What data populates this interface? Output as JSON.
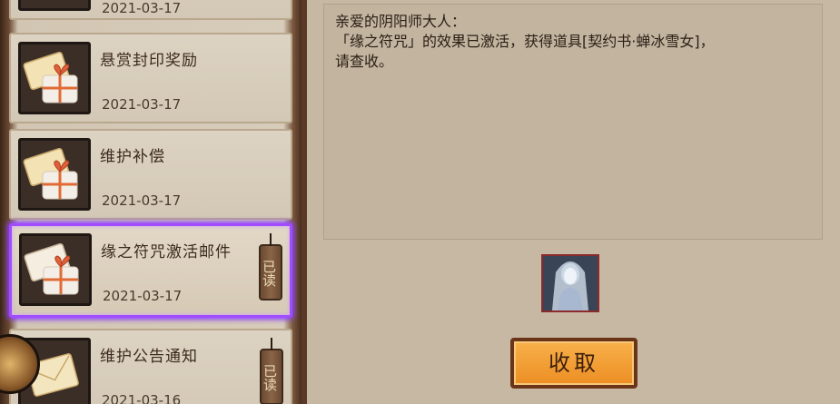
{
  "mail_list": [
    {
      "title": "",
      "date": "2021-03-17",
      "read": false,
      "icon": "gift-envelope-icon"
    },
    {
      "title": "悬赏封印奖励",
      "date": "2021-03-17",
      "read": false,
      "icon": "gift-envelope-icon"
    },
    {
      "title": "维护补偿",
      "date": "2021-03-17",
      "read": false,
      "icon": "gift-envelope-icon"
    },
    {
      "title": "缘之符咒激活邮件",
      "date": "2021-03-17",
      "read": true,
      "read_label": "已读",
      "icon": "gift-envelope-icon",
      "selected": true
    },
    {
      "title": "维护公告通知",
      "date": "2021-03-16",
      "read": true,
      "read_label": "已读",
      "icon": "envelope-icon"
    }
  ],
  "message": {
    "greeting": "亲爱的阴阳师大人：",
    "body_line1": "「缘之符咒」的效果已激活，获得道具[契约书·蝉冰雪女]，",
    "body_line2": "请查收。"
  },
  "reward": {
    "icon": "contract-book-yukionna-icon"
  },
  "collect_button": {
    "label": "收取"
  },
  "colors": {
    "selected_border": "#a24cff",
    "button_fill": "#f0a033",
    "panel_bg": "#c6b8a3"
  }
}
